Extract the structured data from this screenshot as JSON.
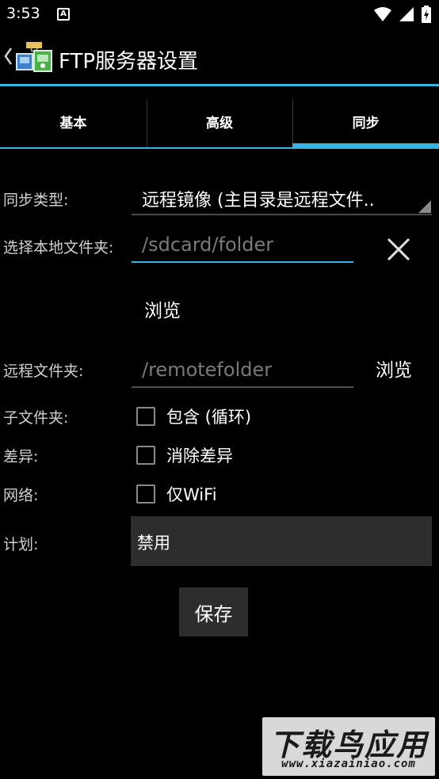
{
  "status_bar": {
    "time": "3:53",
    "notification_letter": "A",
    "icons": [
      "wifi-icon",
      "cellular-signal-icon",
      "battery-charging-icon"
    ]
  },
  "action_bar": {
    "title": "FTP服务器设置",
    "accent_color": "#33b5e5"
  },
  "tabs": [
    {
      "label": "基本",
      "selected": false
    },
    {
      "label": "高级",
      "selected": false
    },
    {
      "label": "同步",
      "selected": true
    }
  ],
  "form": {
    "sync_type": {
      "label": "同步类型:",
      "value": "远程镜像 (主目录是远程文件.."
    },
    "local_folder": {
      "label": "选择本地文件夹:",
      "placeholder": "/sdcard/folder",
      "value": "",
      "browse_label": "浏览"
    },
    "remote_folder": {
      "label": "远程文件夹:",
      "placeholder": "/remotefolder",
      "value": "",
      "browse_label": "浏览"
    },
    "subfolders": {
      "label": "子文件夹:",
      "option": "包含 (循环)",
      "checked": false
    },
    "diff": {
      "label": "差异:",
      "option": "消除差异",
      "checked": false
    },
    "network": {
      "label": "网络:",
      "option": "仅WiFi",
      "checked": false
    },
    "schedule": {
      "label": "计划:",
      "value": "禁用"
    },
    "save_label": "保存"
  },
  "watermark": {
    "main": "下载鸟应用",
    "sub": "www.xiazainiao.com"
  }
}
